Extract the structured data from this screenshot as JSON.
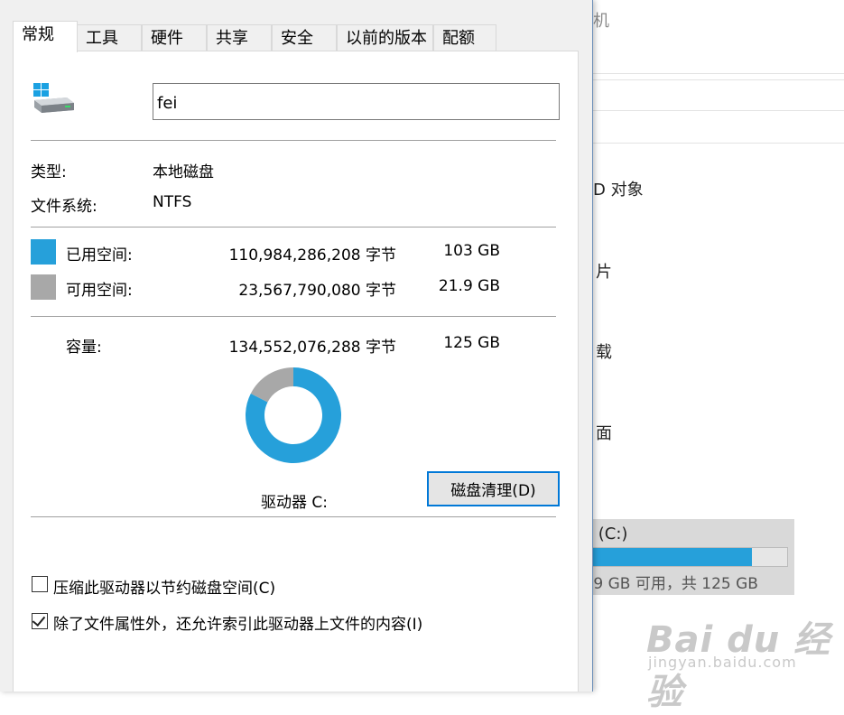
{
  "background_window": {
    "item_computer": "机",
    "item_3d": "D 对象",
    "item_pictures": "片",
    "item_downloads": "载",
    "item_desktop": "面",
    "drive_name": "i (C:)",
    "drive_space": ".9 GB 可用，共 125 GB",
    "drive_used_fraction": 0.825,
    "watermark_logo": "Bai du 经验",
    "watermark_url": "jingyan.baidu.com"
  },
  "tabs": [
    {
      "label": "常规",
      "active": true
    },
    {
      "label": "工具",
      "active": false
    },
    {
      "label": "硬件",
      "active": false
    },
    {
      "label": "共享",
      "active": false
    },
    {
      "label": "安全",
      "active": false
    },
    {
      "label": "以前的版本",
      "active": false
    },
    {
      "label": "配额",
      "active": false
    }
  ],
  "drive": {
    "icon": "windows-drive-icon",
    "name_value": "fei",
    "type_label": "类型:",
    "type_value": "本地磁盘",
    "fs_label": "文件系统:",
    "fs_value": "NTFS"
  },
  "space": {
    "used_label": "已用空间:",
    "used_bytes": "110,984,286,208 字节",
    "used_gb": "103 GB",
    "used_color": "#26a0da",
    "free_label": "可用空间:",
    "free_bytes": "23,567,790,080 字节",
    "free_gb": "21.9 GB",
    "free_color": "#a8a8a8",
    "capacity_label": "容量:",
    "capacity_bytes": "134,552,076,288 字节",
    "capacity_gb": "125 GB"
  },
  "chart": {
    "used_fraction": 0.825,
    "drive_label": "驱动器 C:"
  },
  "buttons": {
    "disk_cleanup": "磁盘清理(D)"
  },
  "options": {
    "compress_label": "压缩此驱动器以节约磁盘空间(C)",
    "compress_checked": false,
    "index_label": "除了文件属性外，还允许索引此驱动器上文件的内容(I)",
    "index_checked": true
  }
}
